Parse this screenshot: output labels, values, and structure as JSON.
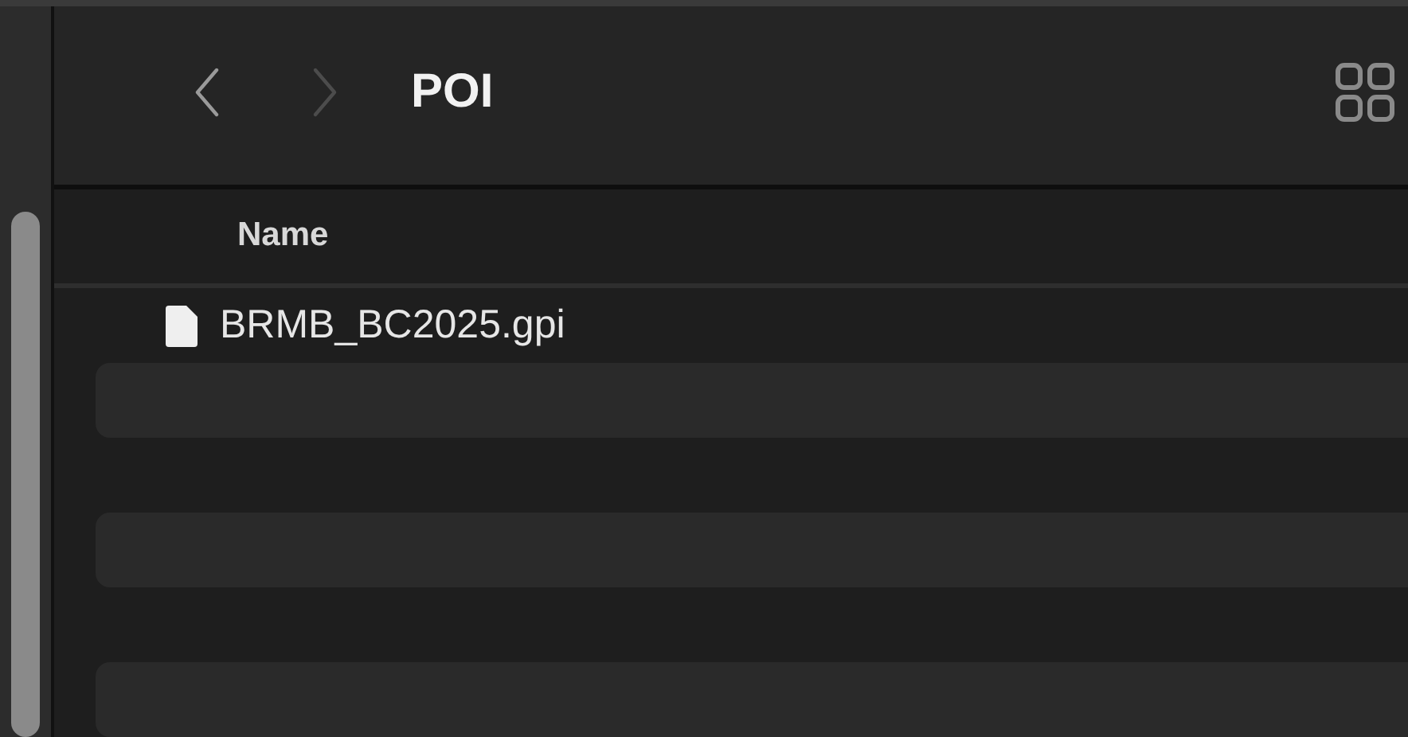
{
  "toolbar": {
    "nav_buttons": [
      {
        "kind": "back",
        "disabled": false
      },
      {
        "kind": "forward",
        "disabled": true
      }
    ],
    "title": "POI"
  },
  "table": {
    "columns": [
      "Name"
    ],
    "rows": [
      {
        "name": "BRMB_BC2025.gpi",
        "selected": false
      }
    ]
  }
}
